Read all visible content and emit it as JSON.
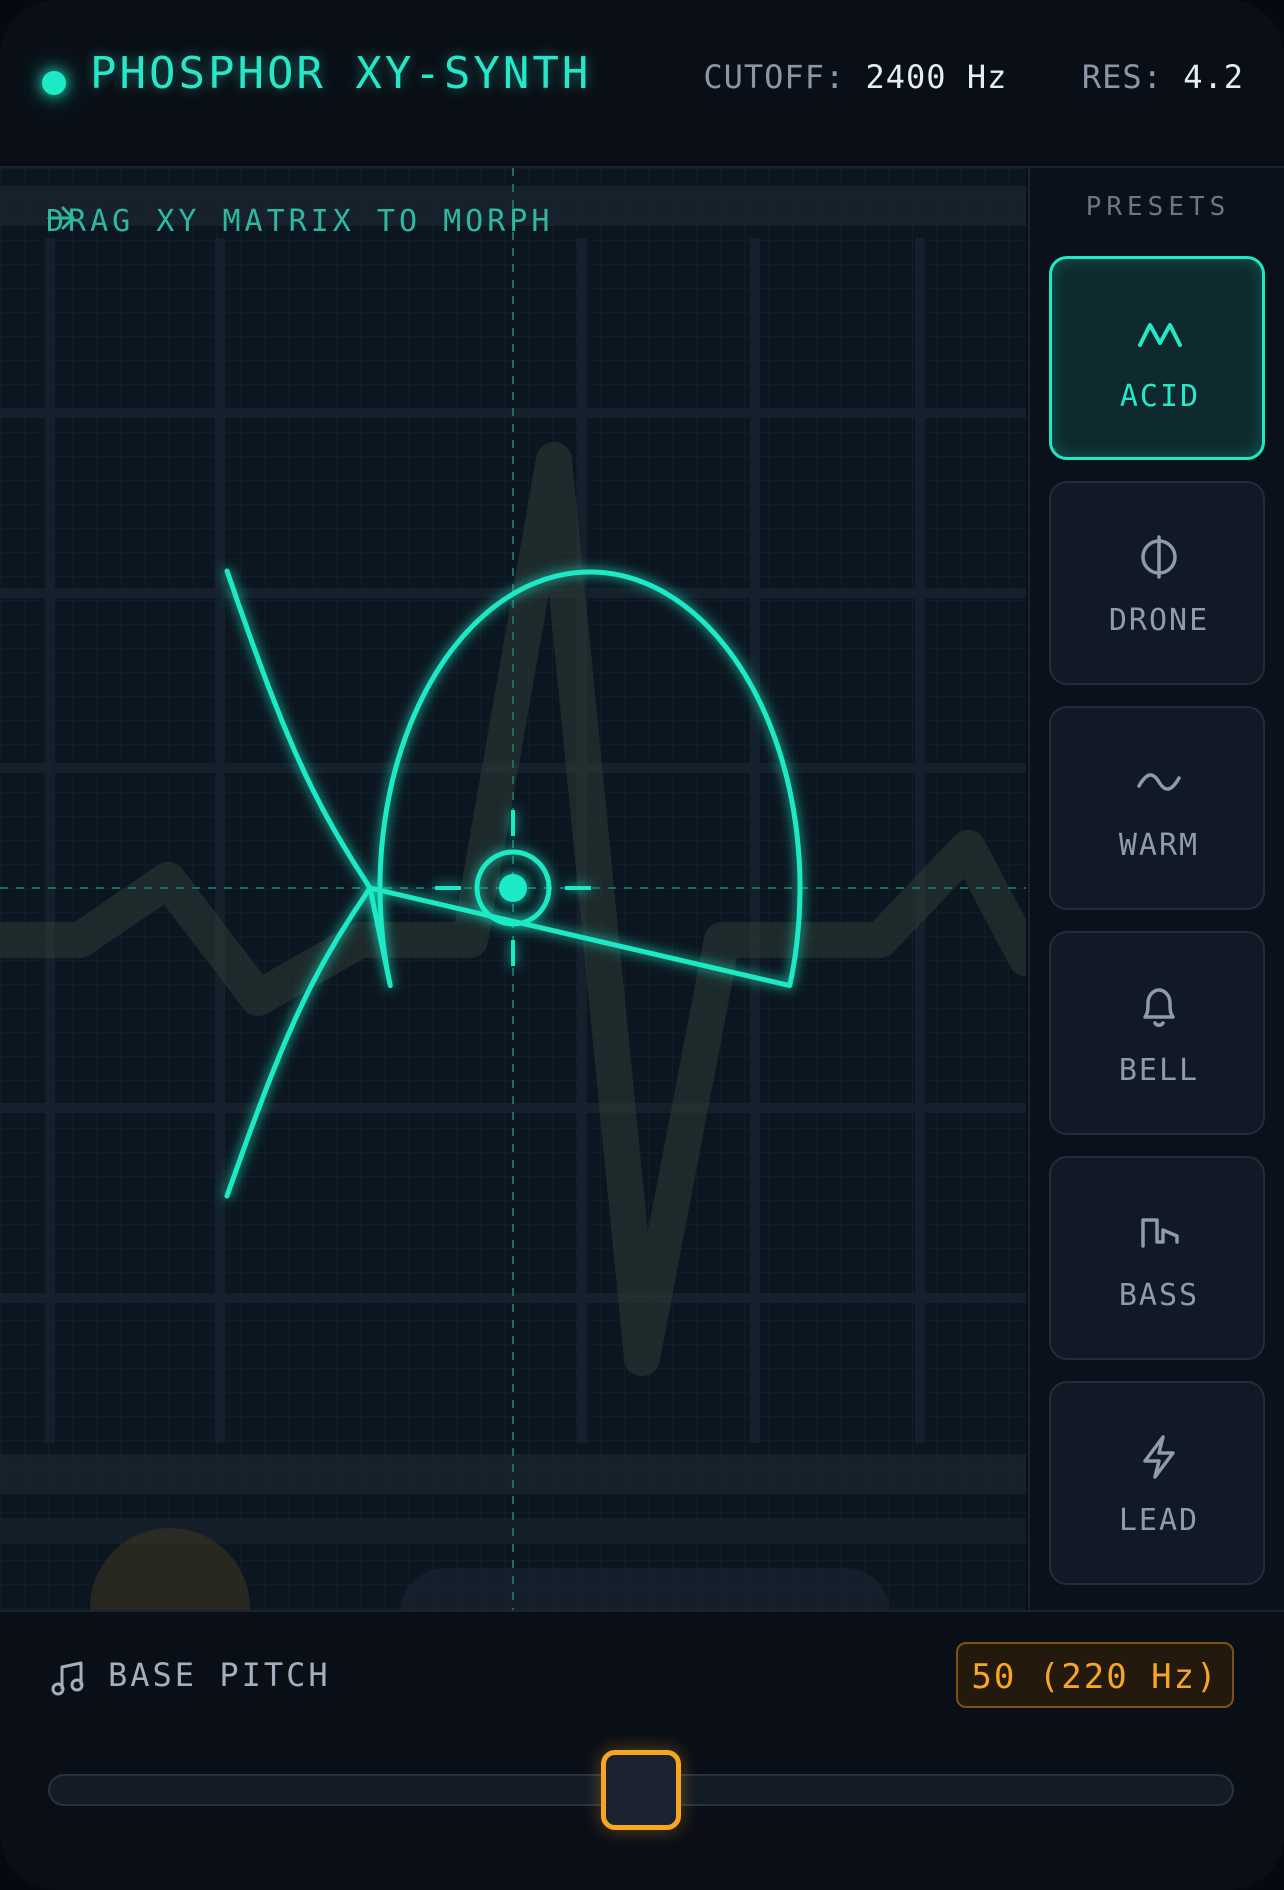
{
  "header": {
    "title": "PHOSPHOR XY-SYNTH",
    "cutoff_label": "CUTOFF:",
    "cutoff_value": "2400 Hz",
    "res_label": "RES:",
    "res_value": "4.2"
  },
  "matrix": {
    "hint": "DRAG XY MATRIX TO MORPH",
    "hint_icon": "arrow-right-icon",
    "cursor_icon": "crosshair-icon",
    "trace_color": "#1de9c5"
  },
  "presets": {
    "title": "PRESETS",
    "active": "ACID",
    "items": [
      {
        "label": "ACID",
        "icon": "zigzag-icon"
      },
      {
        "label": "DRONE",
        "icon": "phi-circle-icon"
      },
      {
        "label": "WARM",
        "icon": "tilde-wave-icon"
      },
      {
        "label": "BELL",
        "icon": "bell-icon"
      },
      {
        "label": "BASS",
        "icon": "step-wave-icon"
      },
      {
        "label": "LEAD",
        "icon": "lightning-icon"
      }
    ]
  },
  "footer": {
    "label": "BASE PITCH",
    "icon": "music-note-icon",
    "value": "50 (220 Hz)",
    "slider_fraction": 0.5
  },
  "colors": {
    "accent": "#1de9c5",
    "warning": "#f6a623",
    "background": "#0a0f17"
  }
}
